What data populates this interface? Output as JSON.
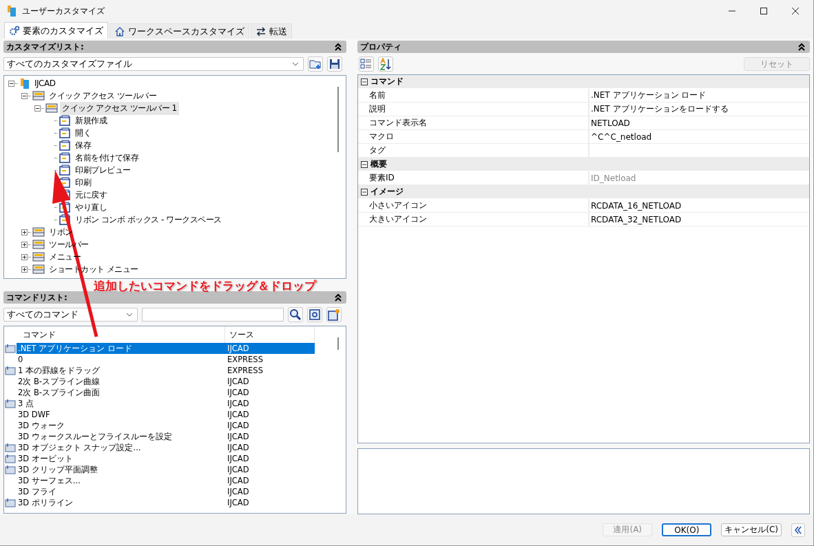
{
  "window": {
    "title": "ユーザーカスタマイズ"
  },
  "tabs": [
    {
      "label": "要素のカスタマイズ",
      "selected": true
    },
    {
      "label": "ワークスペースカスタマイズ",
      "selected": false
    },
    {
      "label": "転送",
      "selected": false
    }
  ],
  "customize": {
    "header": "カスタマイズリスト:",
    "file_select": "すべてのカスタマイズファイル",
    "tree": [
      {
        "label": "IJCAD",
        "expanded": true,
        "selected": false,
        "children": [
          {
            "label": "クイック アクセス ツールバー",
            "expanded": true,
            "selected": false,
            "children": [
              {
                "label": "クイック アクセス ツールバー 1",
                "expanded": true,
                "selected": true,
                "children": [
                  {
                    "label": "新規作成",
                    "selected": false
                  },
                  {
                    "label": "開く",
                    "selected": false
                  },
                  {
                    "label": "保存",
                    "selected": false
                  },
                  {
                    "label": "名前を付けて保存",
                    "selected": false
                  },
                  {
                    "label": "印刷プレビュー",
                    "selected": false
                  },
                  {
                    "label": "印刷",
                    "selected": false
                  },
                  {
                    "label": "元に戻す",
                    "selected": false
                  },
                  {
                    "label": "やり直し",
                    "selected": false
                  },
                  {
                    "label": "リボン コンボ ボックス - ワークスペース",
                    "selected": false
                  }
                ]
              }
            ]
          },
          {
            "label": "リボン",
            "expanded": false,
            "selected": false
          },
          {
            "label": "ツールバー",
            "expanded": false,
            "selected": false
          },
          {
            "label": "メニュー",
            "expanded": false,
            "selected": false
          },
          {
            "label": "ショートカット メニュー",
            "expanded": false,
            "selected": false
          }
        ]
      }
    ]
  },
  "commands": {
    "header": "コマンドリスト:",
    "filter": "すべてのコマンド",
    "columns": [
      "コマンド",
      "ソース"
    ],
    "rows": [
      {
        "command": ".NET アプリケーション ロード",
        "source": "IJCAD",
        "selected": true,
        "icon": true
      },
      {
        "command": "0",
        "source": "EXPRESS",
        "selected": false,
        "icon": false
      },
      {
        "command": "1 本の罫線をドラッグ",
        "source": "EXPRESS",
        "selected": false,
        "icon": true
      },
      {
        "command": "2次 B-スプライン曲線",
        "source": "IJCAD",
        "selected": false,
        "icon": false
      },
      {
        "command": "2次 B-スプライン曲面",
        "source": "IJCAD",
        "selected": false,
        "icon": false
      },
      {
        "command": "3 点",
        "source": "IJCAD",
        "selected": false,
        "icon": true
      },
      {
        "command": "3D DWF",
        "source": "IJCAD",
        "selected": false,
        "icon": false
      },
      {
        "command": "3D ウォーク",
        "source": "IJCAD",
        "selected": false,
        "icon": false
      },
      {
        "command": "3D ウォークスルーとフライスルーを設定",
        "source": "IJCAD",
        "selected": false,
        "icon": false
      },
      {
        "command": "3D オブジェクト スナップ設定...",
        "source": "IJCAD",
        "selected": false,
        "icon": true
      },
      {
        "command": "3D オービット",
        "source": "IJCAD",
        "selected": false,
        "icon": true
      },
      {
        "command": "3D クリップ平面調整",
        "source": "IJCAD",
        "selected": false,
        "icon": true
      },
      {
        "command": "3D サーフェス...",
        "source": "IJCAD",
        "selected": false,
        "icon": false
      },
      {
        "command": "3D フライ",
        "source": "IJCAD",
        "selected": false,
        "icon": false
      },
      {
        "command": "3D ポリライン",
        "source": "IJCAD",
        "selected": false,
        "icon": true
      }
    ]
  },
  "properties": {
    "header": "プロパティ",
    "reset": {
      "label": "リセット",
      "disabled": true
    },
    "categories": [
      {
        "label": "コマンド",
        "expanded": true,
        "rows": [
          {
            "name": "名前",
            "value": ".NET アプリケーション ロード",
            "readonly": false
          },
          {
            "name": "説明",
            "value": ".NET アプリケーションをロードする",
            "readonly": false
          },
          {
            "name": "コマンド表示名",
            "value": "NETLOAD",
            "readonly": false
          },
          {
            "name": "マクロ",
            "value": "^C^C_netload",
            "readonly": false
          },
          {
            "name": "タグ"
          }
        ]
      },
      {
        "label": "概要",
        "expanded": true,
        "rows": [
          {
            "name": "要素ID",
            "value": "ID_Netload",
            "readonly": true
          }
        ]
      },
      {
        "label": "イメージ",
        "expanded": true,
        "rows": [
          {
            "name": "小さいアイコン",
            "value": "RCDATA_16_NETLOAD",
            "readonly": false
          },
          {
            "name": "大きいアイコン",
            "value": "RCDATA_32_NETLOAD",
            "readonly": false
          }
        ]
      }
    ]
  },
  "annotation": {
    "text": "追加したいコマンドをドラッグ＆ドロップ"
  },
  "buttons": [
    {
      "label": "適用(A)",
      "disabled": true,
      "default": false
    },
    {
      "label": "OK(O)",
      "disabled": false,
      "default": true
    },
    {
      "label": "キャンセル(C)",
      "disabled": false,
      "default": false
    }
  ]
}
